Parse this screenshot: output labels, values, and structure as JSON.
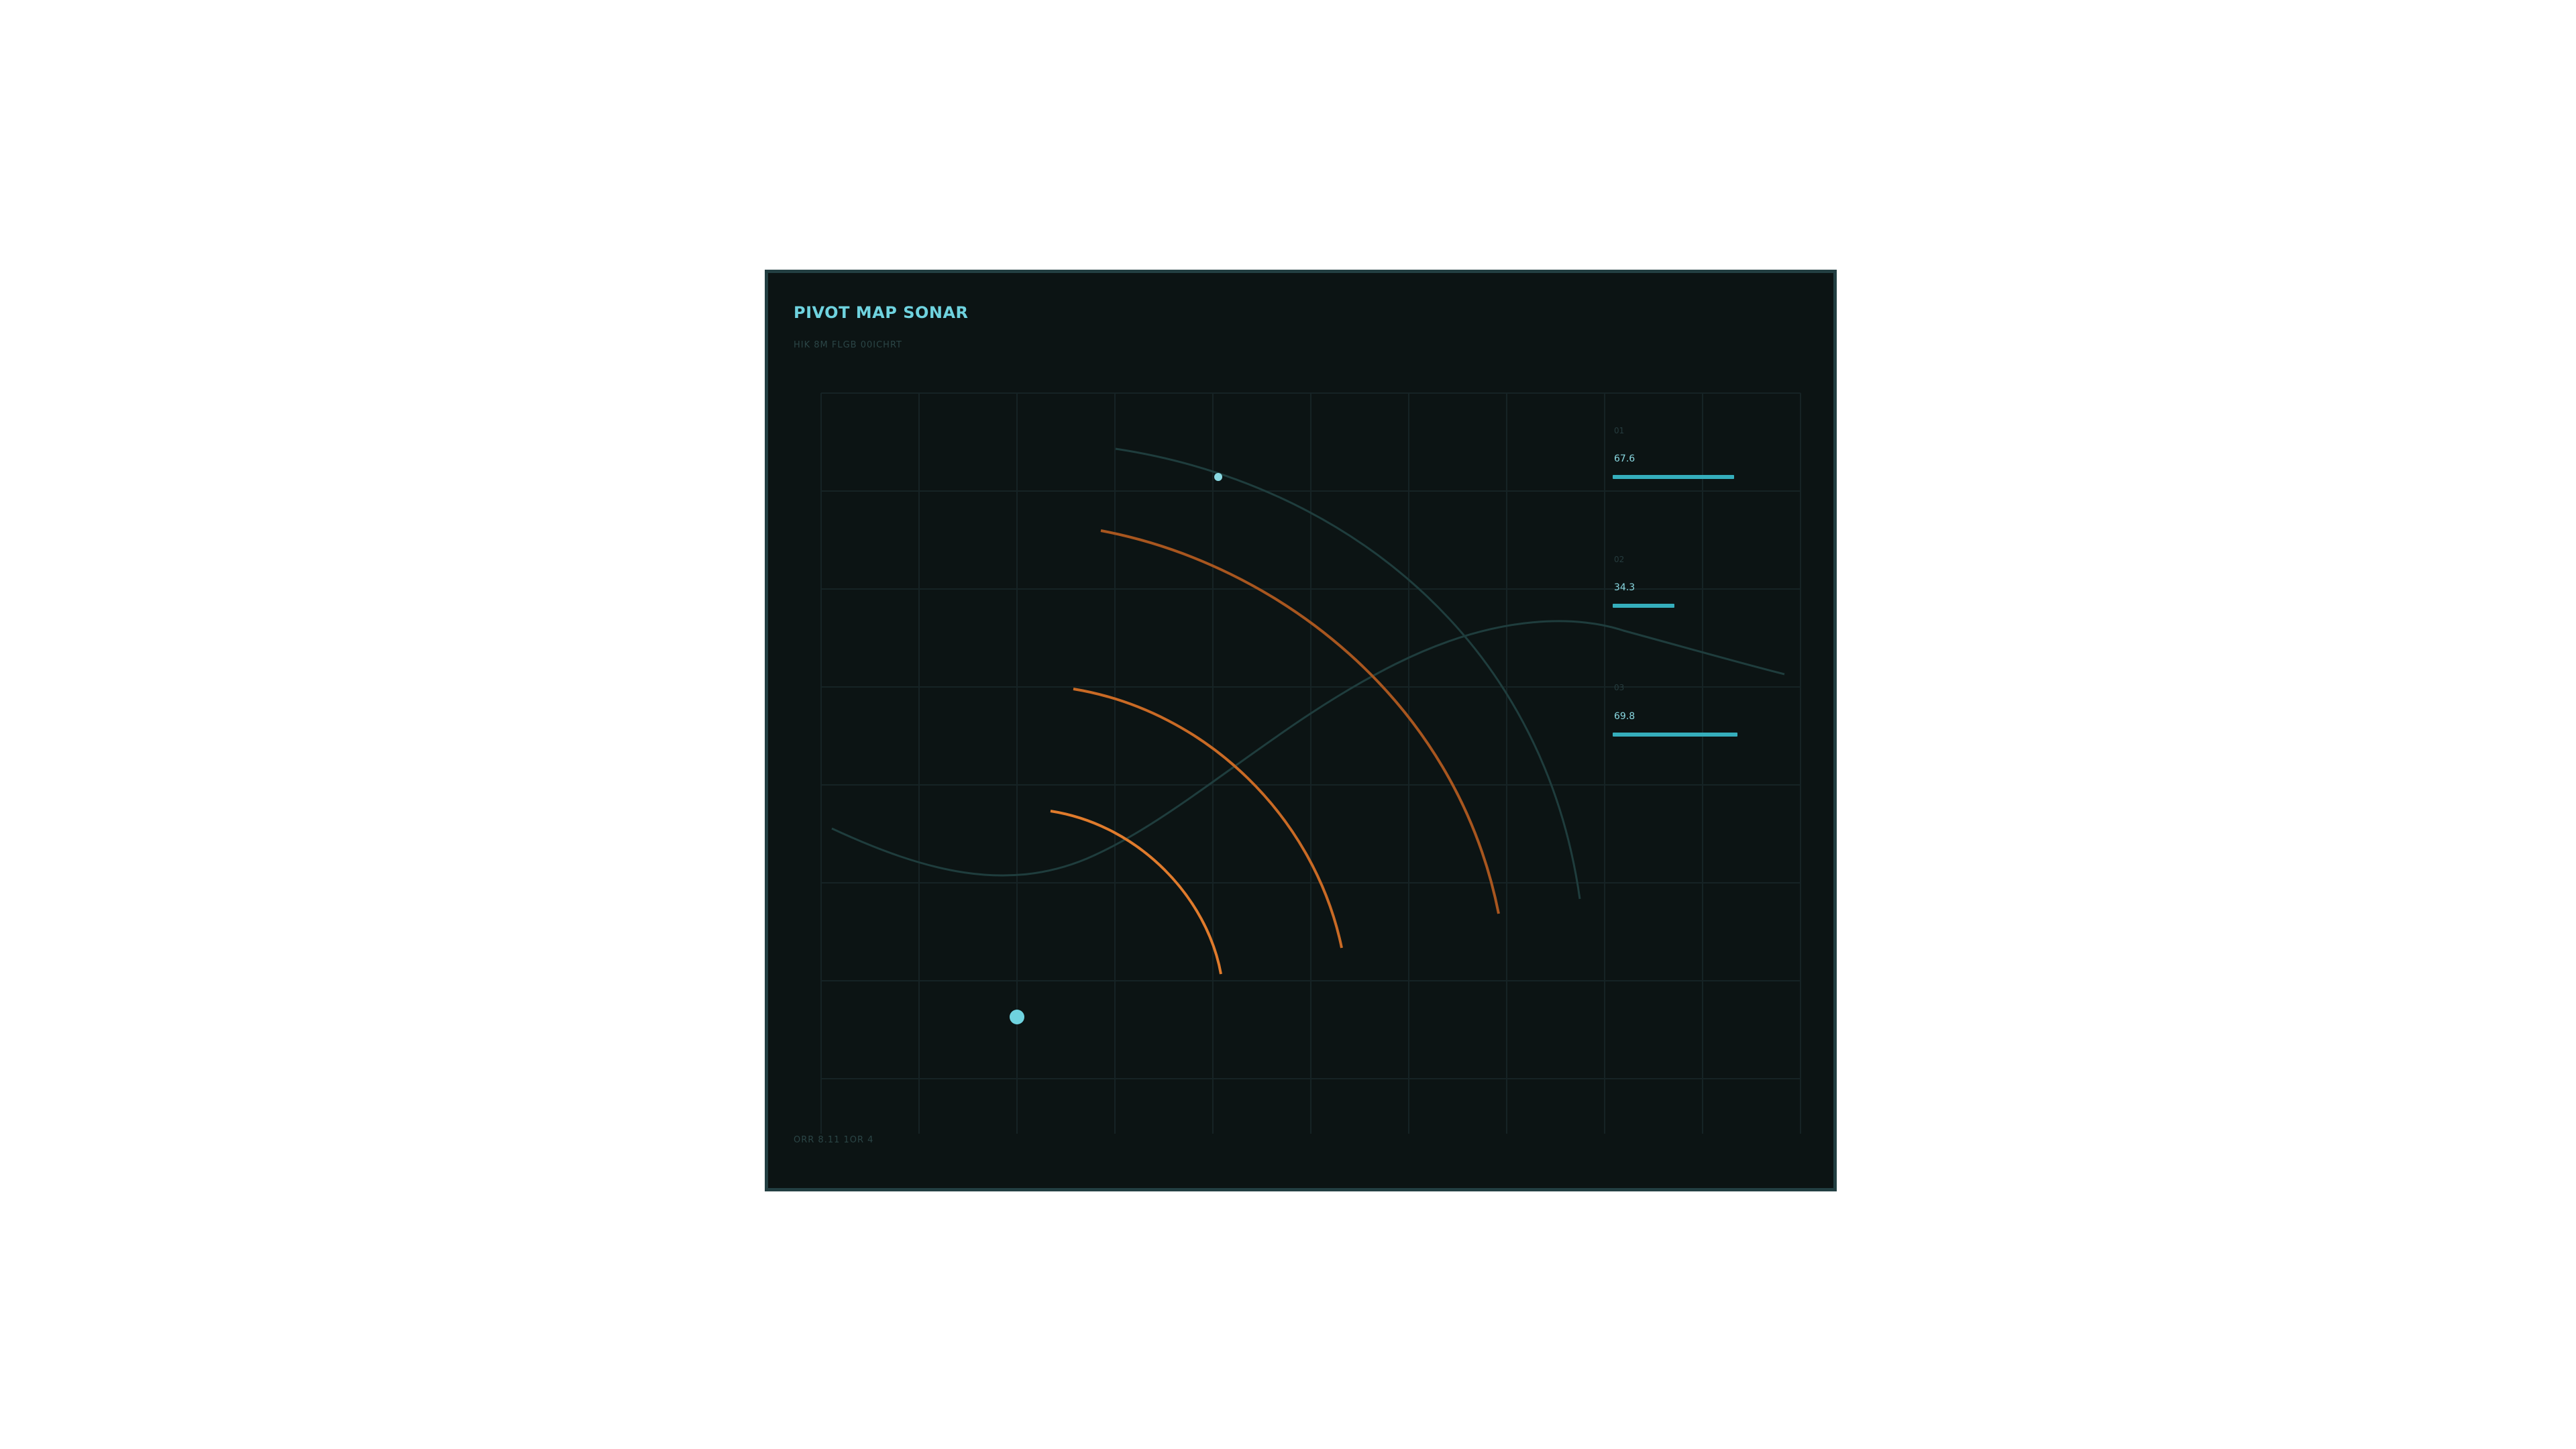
{
  "header": {
    "title": "PIVOT MAP SONAR",
    "subtitle": "HIK 8M FLGB 00ICHRT"
  },
  "footer": {
    "text": "ORR 8.11 1OR 4"
  },
  "metrics": [
    {
      "label": "01",
      "value": "67.6",
      "fraction": 0.73
    },
    {
      "label": "02",
      "value": "34.3",
      "fraction": 0.37
    },
    {
      "label": "03",
      "value": "69.8",
      "fraction": 0.75
    }
  ],
  "colors": {
    "background": "#0c1414",
    "border": "#233f42",
    "accent_cyan": "#6fd3df",
    "accent_orange": "#e07b2c",
    "trace": "#1f3d3d",
    "grid": "#162325"
  }
}
